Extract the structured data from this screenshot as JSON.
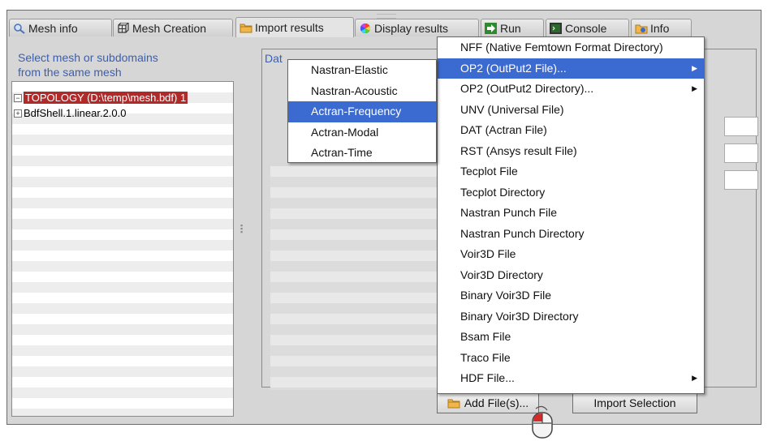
{
  "tabs": [
    {
      "label": "Mesh info",
      "icon": "magnifier-icon"
    },
    {
      "label": "Mesh Creation",
      "icon": "mesh-cube-icon"
    },
    {
      "label": "Import results",
      "icon": "folder-icon"
    },
    {
      "label": "Display results",
      "icon": "color-wheel-icon"
    },
    {
      "label": "Run",
      "icon": "run-arrow-icon"
    },
    {
      "label": "Console",
      "icon": "console-icon"
    },
    {
      "label": "Info",
      "icon": "info-folder-icon"
    }
  ],
  "left": {
    "label_line1": "Select mesh or subdomains",
    "label_line2": "from the same mesh",
    "tree": [
      {
        "label": "TOPOLOGY (D:\\temp\\mesh.bdf) 1",
        "selected": true
      },
      {
        "label": "BdfShell.1.linear.2.0.0",
        "selected": false
      }
    ]
  },
  "right": {
    "label": "Dat"
  },
  "buttons": {
    "add_files": "Add File(s)...",
    "import_selection": "Import Selection"
  },
  "main_menu": [
    {
      "label": "NFF (Native Femtown Format Directory)",
      "submenu": false
    },
    {
      "label": "OP2 (OutPut2 File)...",
      "submenu": true,
      "highlighted": true
    },
    {
      "label": "OP2 (OutPut2 Directory)...",
      "submenu": true
    },
    {
      "label": "UNV (Universal File)",
      "submenu": false
    },
    {
      "label": "DAT (Actran File)",
      "submenu": false
    },
    {
      "label": "RST (Ansys result File)",
      "submenu": false
    },
    {
      "label": "Tecplot File",
      "submenu": false
    },
    {
      "label": "Tecplot Directory",
      "submenu": false
    },
    {
      "label": "Nastran Punch File",
      "submenu": false
    },
    {
      "label": "Nastran Punch Directory",
      "submenu": false
    },
    {
      "label": "Voir3D File",
      "submenu": false
    },
    {
      "label": "Voir3D Directory",
      "submenu": false
    },
    {
      "label": "Binary Voir3D File",
      "submenu": false
    },
    {
      "label": "Binary Voir3D Directory",
      "submenu": false
    },
    {
      "label": "Bsam File",
      "submenu": false
    },
    {
      "label": "Traco File",
      "submenu": false
    },
    {
      "label": "HDF File...",
      "submenu": true
    }
  ],
  "sub_menu": [
    {
      "label": "Nastran-Elastic"
    },
    {
      "label": "Nastran-Acoustic"
    },
    {
      "label": "Actran-Frequency",
      "highlighted": true
    },
    {
      "label": "Actran-Modal"
    },
    {
      "label": "Actran-Time"
    }
  ],
  "colors": {
    "accent": "#3b6ad0",
    "label_blue": "#3b5fb0",
    "selection_red": "#b02a2a"
  }
}
